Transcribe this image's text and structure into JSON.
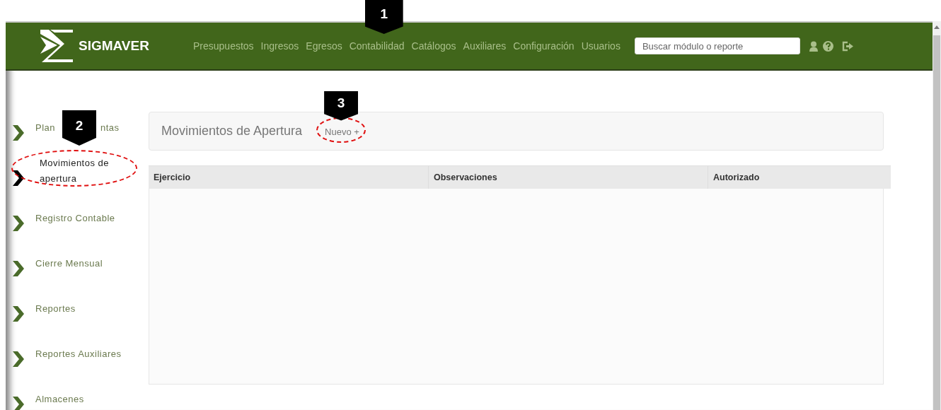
{
  "header": {
    "brand": "SIGMAVER",
    "nav": [
      {
        "label": "Presupuestos"
      },
      {
        "label": "Ingresos"
      },
      {
        "label": "Egresos"
      },
      {
        "label": "Contabilidad",
        "callout": "1"
      },
      {
        "label": "Catálogos"
      },
      {
        "label": "Auxiliares"
      },
      {
        "label": "Configuración"
      },
      {
        "label": "Usuarios"
      }
    ],
    "search": {
      "placeholder": "Buscar módulo o reporte"
    }
  },
  "sidebar": {
    "items": [
      {
        "label_parts": [
          "Plan",
          "ntas"
        ],
        "selected": false,
        "highlighted": false
      },
      {
        "label_parts": [
          "Movimientos de apertura"
        ],
        "selected": true,
        "highlighted": true,
        "callout": "2"
      },
      {
        "label_parts": [
          "Registro Contable"
        ],
        "selected": false,
        "highlighted": false
      },
      {
        "label_parts": [
          "Cierre Mensual"
        ],
        "selected": false,
        "highlighted": false
      },
      {
        "label_parts": [
          "Reportes"
        ],
        "selected": false,
        "highlighted": false
      },
      {
        "label_parts": [
          "Reportes Auxiliares"
        ],
        "selected": false,
        "highlighted": false
      },
      {
        "label_parts": [
          "Almacenes"
        ],
        "selected": false,
        "highlighted": false
      }
    ]
  },
  "panel": {
    "title": "Movimientos de Apertura",
    "new_button": {
      "label": "Nuevo +",
      "highlighted": true,
      "callout": "3"
    }
  },
  "table": {
    "columns": [
      "Ejercicio",
      "Observaciones",
      "Autorizado"
    ]
  }
}
